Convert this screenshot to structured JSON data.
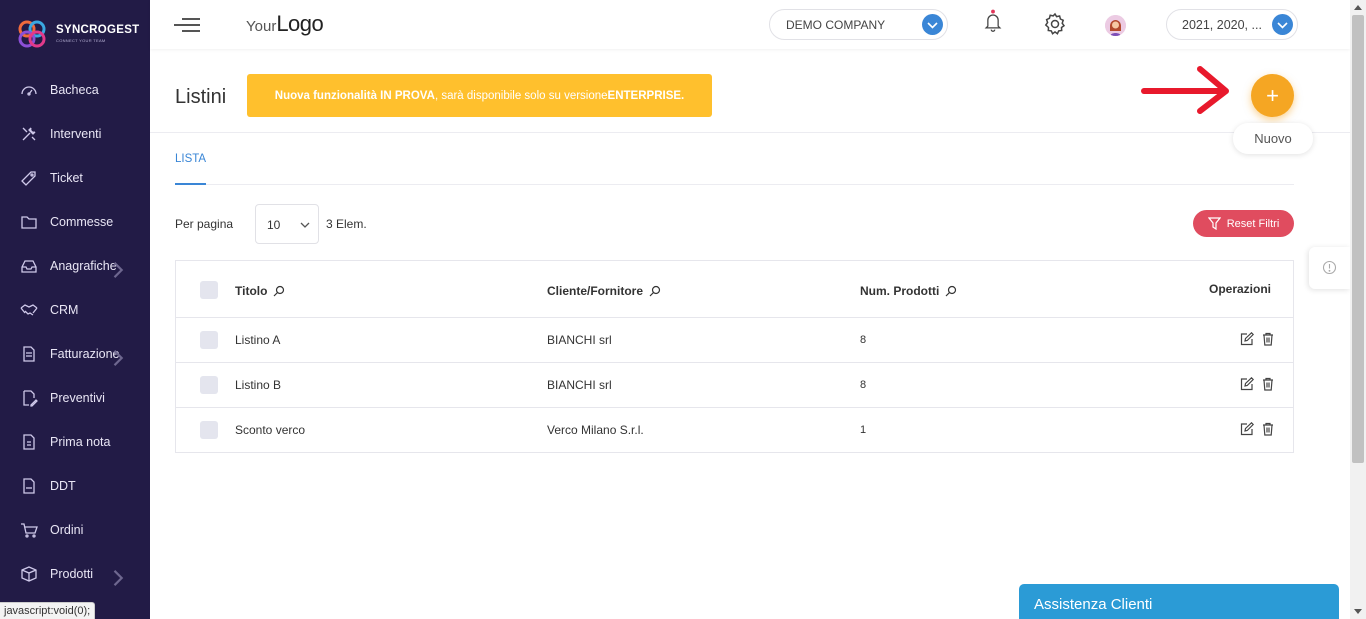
{
  "brand": {
    "name": "SYNCROGEST",
    "tagline": "CONNECT YOUR TEAM"
  },
  "sidebar": {
    "items": [
      {
        "label": "Bacheca",
        "icon": "dashboard-icon",
        "has_submenu": false
      },
      {
        "label": "Interventi",
        "icon": "tools-icon",
        "has_submenu": false
      },
      {
        "label": "Ticket",
        "icon": "ticket-icon",
        "has_submenu": false
      },
      {
        "label": "Commesse",
        "icon": "folder-icon",
        "has_submenu": false
      },
      {
        "label": "Anagrafiche",
        "icon": "inbox-icon",
        "has_submenu": true
      },
      {
        "label": "CRM",
        "icon": "handshake-icon",
        "has_submenu": false
      },
      {
        "label": "Fatturazione",
        "icon": "invoice-icon",
        "has_submenu": true
      },
      {
        "label": "Preventivi",
        "icon": "edit-file-icon",
        "has_submenu": false
      },
      {
        "label": "Prima nota",
        "icon": "ledger-icon",
        "has_submenu": false
      },
      {
        "label": "DDT",
        "icon": "ddt-file-icon",
        "has_submenu": false
      },
      {
        "label": "Ordini",
        "icon": "cart-icon",
        "has_submenu": false
      },
      {
        "label": "Prodotti",
        "icon": "box-icon",
        "has_submenu": true
      }
    ]
  },
  "header": {
    "logo_prefix": "Your",
    "logo_main": "Logo",
    "company": "DEMO COMPANY",
    "years": "2021, 2020, ..."
  },
  "page": {
    "title": "Listini",
    "banner_bold_1": "Nuova funzionalità IN PROVA",
    "banner_text": ", sarà disponibile solo su versione ",
    "banner_bold_2": "ENTERPRISE.",
    "fab_label": "+",
    "fab_tooltip": "Nuovo",
    "tab": "LISTA"
  },
  "controls": {
    "per_page_label": "Per pagina",
    "per_page_value": "10",
    "count_text": "3 Elem.",
    "reset_label": "Reset Filtri"
  },
  "table": {
    "columns": [
      "Titolo",
      "Cliente/Fornitore",
      "Num. Prodotti",
      "Operazioni"
    ],
    "rows": [
      {
        "titolo": "Listino A",
        "cliente": "BIANCHI srl",
        "num": "8"
      },
      {
        "titolo": "Listino B",
        "cliente": "BIANCHI srl",
        "num": "8"
      },
      {
        "titolo": "Sconto verco",
        "cliente": "Verco Milano S.r.l.",
        "num": "1"
      }
    ]
  },
  "assist_label": "Assistenza Clienti",
  "status_tip": "javascript:void(0);",
  "colors": {
    "sidebar_bg": "#221b46",
    "accent_blue": "#3a86d6",
    "banner_yellow": "#ffc02d",
    "fab_orange": "#f5a623",
    "reset_red": "#e04c5f",
    "arrow_red": "#e8192c",
    "assist_blue": "#2b9bd6"
  }
}
